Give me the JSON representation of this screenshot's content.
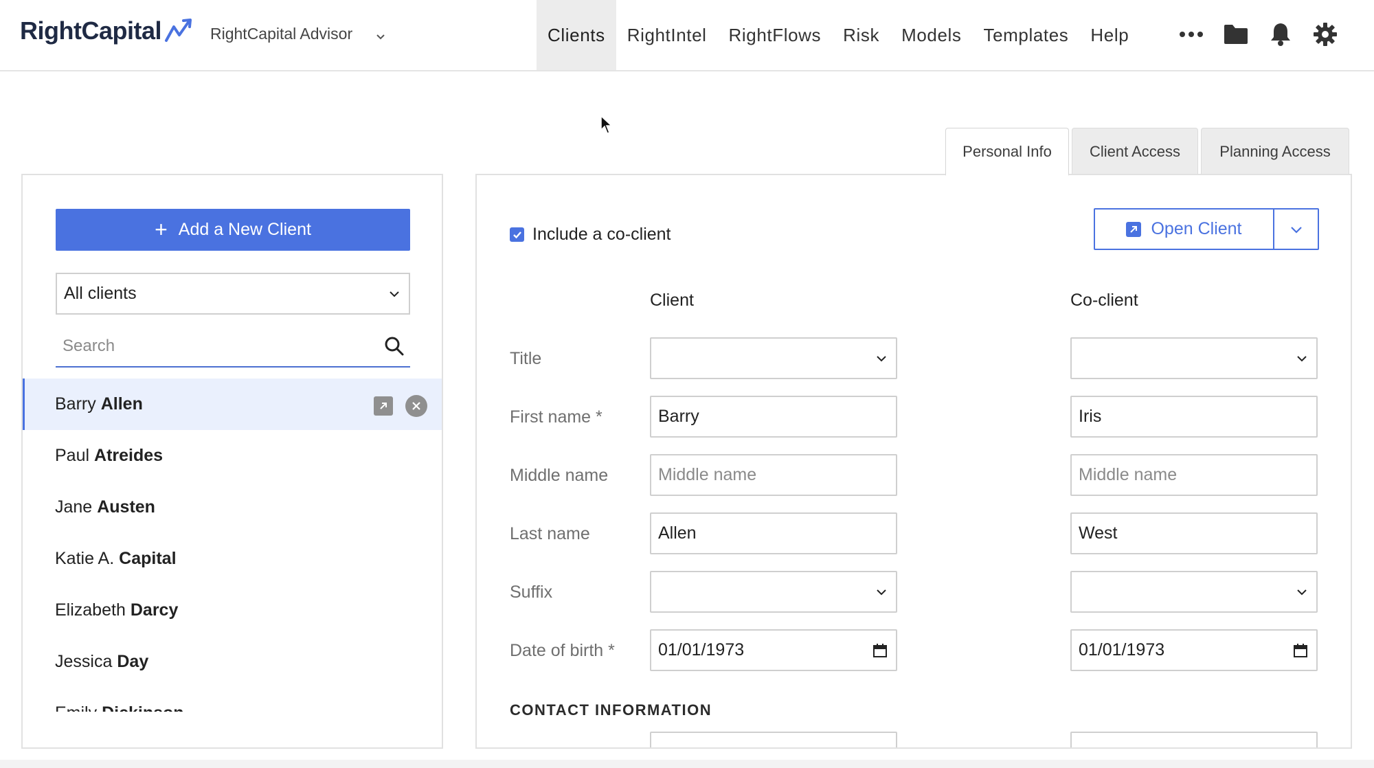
{
  "brand": {
    "logo_text": "RightCapital",
    "advisor": "RightCapital Advisor"
  },
  "nav": {
    "items": [
      {
        "label": "Clients",
        "active": true
      },
      {
        "label": "RightIntel"
      },
      {
        "label": "RightFlows"
      },
      {
        "label": "Risk"
      },
      {
        "label": "Models"
      },
      {
        "label": "Templates"
      },
      {
        "label": "Help"
      }
    ],
    "more_icon": "more-icon",
    "icons": [
      "folder-icon",
      "bell-icon",
      "gear-icon"
    ]
  },
  "tabs": [
    {
      "label": "Personal Info",
      "active": true
    },
    {
      "label": "Client Access"
    },
    {
      "label": "Planning Access"
    }
  ],
  "left": {
    "add_button": "Add a New Client",
    "filter": "All clients",
    "search_placeholder": "Search",
    "clients": [
      {
        "first": "Barry",
        "last": "Allen",
        "selected": true
      },
      {
        "first": "Paul",
        "last": "Atreides"
      },
      {
        "first": "Jane",
        "last": "Austen"
      },
      {
        "first": "Katie A.",
        "last": "Capital"
      },
      {
        "first": "Elizabeth",
        "last": "Darcy"
      },
      {
        "first": "Jessica",
        "last": "Day"
      },
      {
        "first": "Emily",
        "last": "Dickinson"
      }
    ]
  },
  "form": {
    "coclient_label": "Include a co-client",
    "coclient_checked": true,
    "open_client": "Open Client",
    "col_client": "Client",
    "col_coclient": "Co-client",
    "labels": {
      "title": "Title",
      "first_name": "First name *",
      "middle_name": "Middle name",
      "last_name": "Last name",
      "suffix": "Suffix",
      "dob": "Date of birth *"
    },
    "client": {
      "title": "",
      "first_name": "Barry",
      "middle_placeholder": "Middle name",
      "last_name": "Allen",
      "suffix": "",
      "dob": "01/01/1973"
    },
    "coclient": {
      "title": "",
      "first_name": "Iris",
      "middle_placeholder": "Middle name",
      "last_name": "West",
      "suffix": "",
      "dob": "01/01/1973"
    },
    "contact_section": "CONTACT INFORMATION"
  },
  "colors": {
    "accent": "#4a72e0",
    "selected_row": "#eaf0fd"
  }
}
